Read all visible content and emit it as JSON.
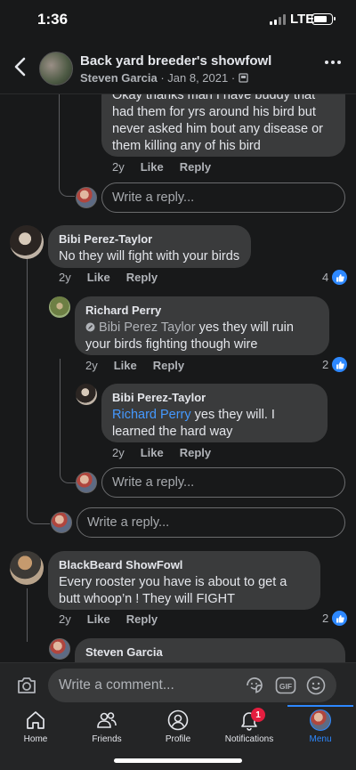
{
  "status_bar": {
    "time": "1:36",
    "network": "LTE"
  },
  "header": {
    "group_title": "Back yard breeder's showfowl",
    "author": "Steven Garcia",
    "date": "· Jan 8, 2021 ·"
  },
  "comments": {
    "partial": {
      "text": "Okay thanks man I have buddy that had them for yrs around his bird but never asked him bout any disease  or them killing any of his bird",
      "age": "2y",
      "like": "Like",
      "reply": "Reply"
    },
    "reply_placeholder": "Write a reply...",
    "bibi": {
      "name": "Bibi Perez-Taylor",
      "text": "No they will fight with your birds",
      "age": "2y",
      "like": "Like",
      "reply": "Reply",
      "reactions": "4"
    },
    "richard": {
      "name": "Richard Perry",
      "mention": "Bibi Perez Taylor",
      "text": "yes they will ruin your birds fighting though wire",
      "age": "2y",
      "like": "Like",
      "reply": "Reply",
      "reactions": "2"
    },
    "bibi_reply": {
      "name": "Bibi Perez-Taylor",
      "mention": "Richard Perry",
      "text": "yes they will. I learned the hard way",
      "age": "2y",
      "like": "Like",
      "reply": "Reply"
    },
    "blackbeard": {
      "name": "BlackBeard ShowFowl",
      "text": "Every rooster you have is about to get a butt whoop’n ! They will FIGHT",
      "age": "2y",
      "like": "Like",
      "reply": "Reply",
      "reactions": "2"
    },
    "steven": {
      "name": "Steven Garcia"
    }
  },
  "composer": {
    "placeholder": "Write a comment..."
  },
  "tabs": [
    {
      "label": "Home",
      "icon": "home-icon"
    },
    {
      "label": "Friends",
      "icon": "friends-icon"
    },
    {
      "label": "Profile",
      "icon": "profile-icon"
    },
    {
      "label": "Notifications",
      "icon": "bell-icon",
      "badge": "1"
    },
    {
      "label": "Menu",
      "icon": "menu-avatar-icon"
    }
  ],
  "colors": {
    "accent": "#2d88ff",
    "background": "#18191a",
    "bubble": "#3a3b3c",
    "badge": "#e41e3f"
  }
}
